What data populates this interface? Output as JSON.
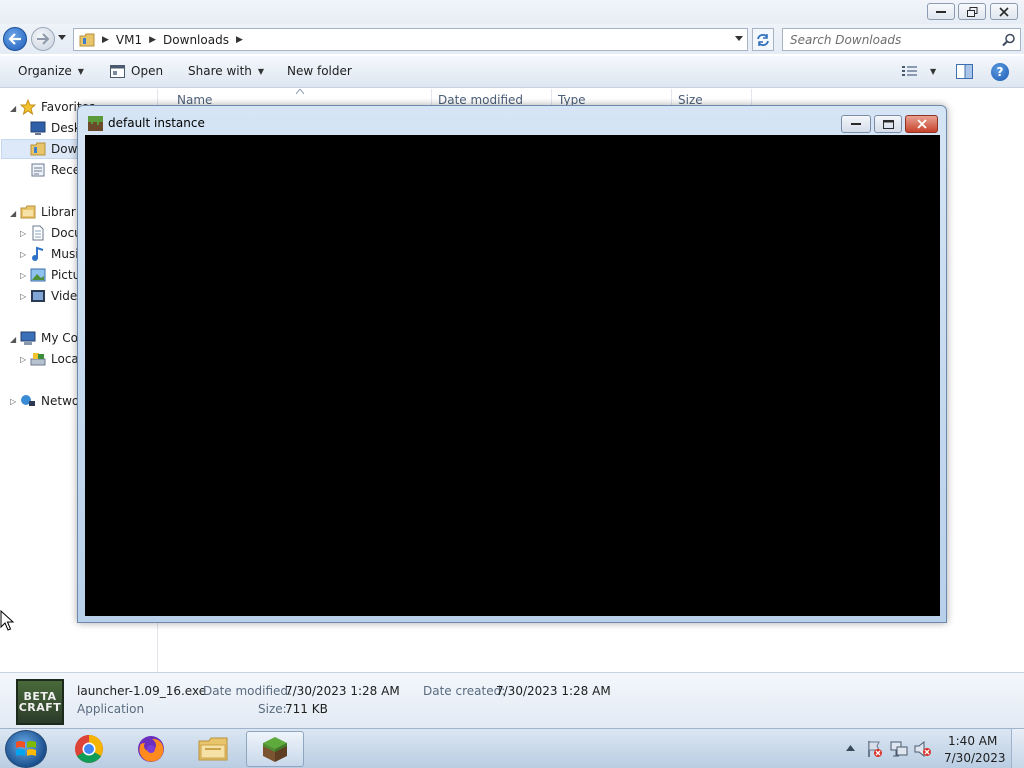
{
  "explorer": {
    "address": {
      "crumbs": [
        "VM1",
        "Downloads"
      ]
    },
    "search": {
      "placeholder": "Search Downloads"
    },
    "commands": {
      "organize": "Organize",
      "open": "Open",
      "share_with": "Share with",
      "new_folder": "New folder"
    },
    "nav": {
      "favorites": "Favorites",
      "desktop": "Desktop",
      "downloads": "Downloads",
      "recent": "Recent Places",
      "libraries": "Libraries",
      "documents": "Documents",
      "music": "Music",
      "pictures": "Pictures",
      "videos": "Videos",
      "computer": "My Computer",
      "local_disk": "Local Disk (C:)",
      "network": "Network"
    },
    "columns": [
      "Name",
      "Date modified",
      "Type",
      "Size"
    ],
    "details": {
      "file_name": "launcher-1.09_16.exe",
      "file_type": "Application",
      "date_modified_label": "Date modified:",
      "date_modified": "7/30/2023 1:28 AM",
      "date_created_label": "Date created:",
      "date_created": "7/30/2023 1:28 AM",
      "size_label": "Size:",
      "size": "711 KB",
      "logo_line1": "BETA",
      "logo_line2": "CRAFT"
    }
  },
  "game_window": {
    "title": "default instance"
  },
  "taskbar": {
    "time": "1:40 AM",
    "date": "7/30/2023"
  },
  "colors": {
    "accent": "#1f5fb9",
    "canvas": "#000000",
    "close": "#c6432c"
  },
  "icons": {
    "taskbar_apps": [
      "chrome-icon",
      "firefox-icon",
      "explorer-folder-icon",
      "minecraft-grass-icon"
    ],
    "tray": [
      "show-hidden-icons",
      "action-center-flag-icon",
      "network-icon",
      "speaker-muted-icon"
    ]
  }
}
